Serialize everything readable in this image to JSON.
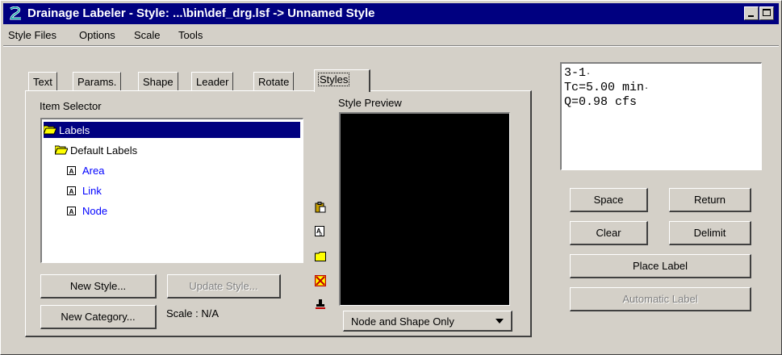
{
  "window": {
    "title": "Drainage Labeler - Style: ...\\bin\\def_drg.lsf -> Unnamed Style"
  },
  "menu": {
    "items": [
      {
        "label": "Style Files"
      },
      {
        "label": "Options"
      },
      {
        "label": "Scale"
      },
      {
        "label": "Tools"
      }
    ]
  },
  "tabs": [
    {
      "label": "Text"
    },
    {
      "label": "Params."
    },
    {
      "label": "Shape"
    },
    {
      "label": "Leader"
    },
    {
      "label": "Rotate"
    },
    {
      "label": "Styles",
      "active": true
    }
  ],
  "item_selector": {
    "label": "Item Selector",
    "tree": [
      {
        "label": "Labels",
        "type": "folder",
        "selected": true
      },
      {
        "label": "Default Labels",
        "type": "folder"
      },
      {
        "label": "Area",
        "type": "item"
      },
      {
        "label": "Link",
        "type": "item"
      },
      {
        "label": "Node",
        "type": "item"
      }
    ]
  },
  "style_preview": {
    "label": "Style Preview",
    "dropdown_value": "Node and Shape Only"
  },
  "buttons": {
    "new_style": "New Style...",
    "update_style": "Update Style...",
    "new_category": "New Category...",
    "space": "Space",
    "return": "Return",
    "clear": "Clear",
    "delimit": "Delimit",
    "place_label": "Place Label",
    "automatic_label": "Automatic Label"
  },
  "scale_text": "Scale : N/A",
  "label_text": {
    "lines": [
      "3-1",
      "Tc=5.00 min",
      "Q=0.98 cfs"
    ]
  },
  "tool_icons": [
    "paste-icon",
    "copy-style-icon",
    "folder-icon",
    "delete-icon",
    "stamp-icon"
  ]
}
